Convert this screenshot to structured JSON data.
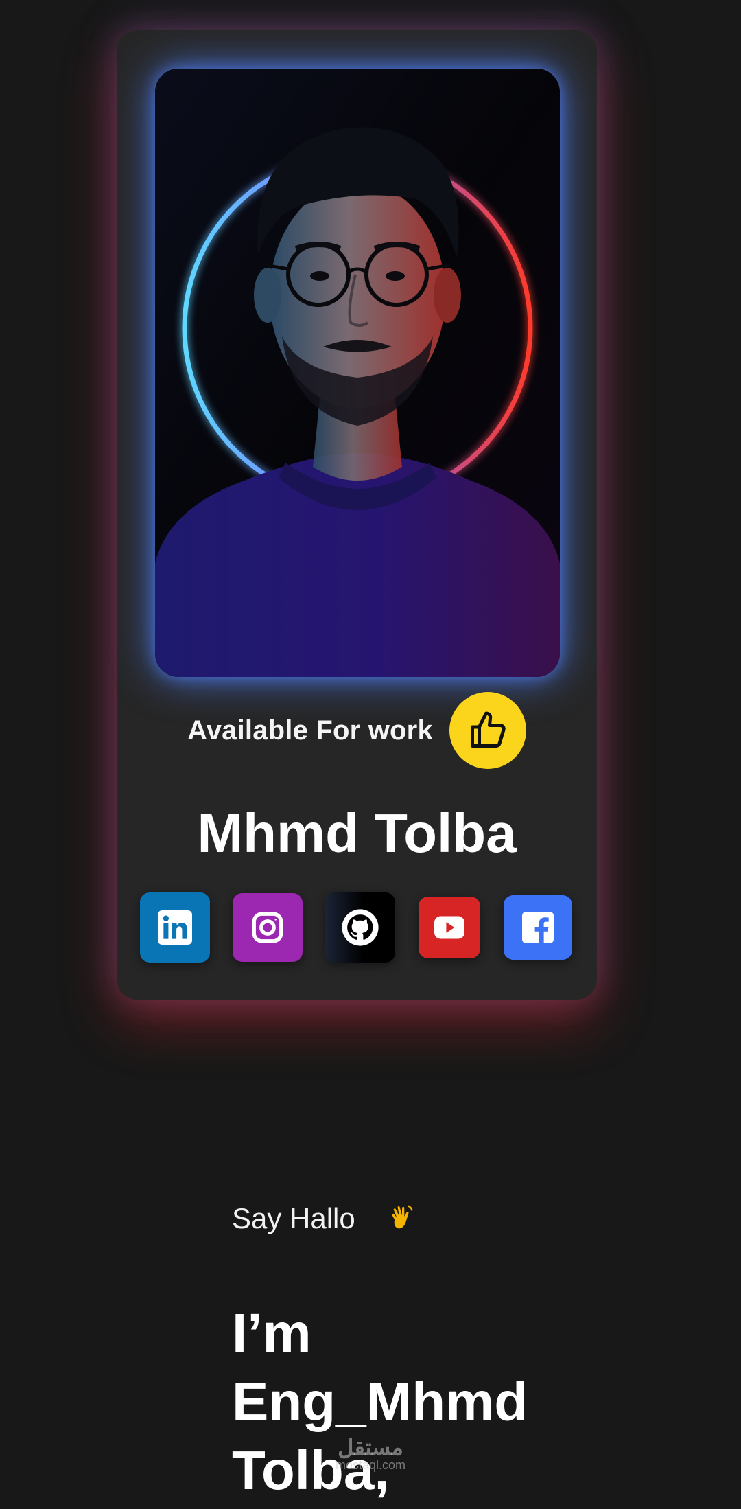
{
  "profile": {
    "availability": "Available For work",
    "name": "Mhmd Tolba",
    "photo_icon": "portrait-photo",
    "badge_icon": "thumbs-up-icon"
  },
  "socials": [
    {
      "network": "LinkedIn",
      "icon": "linkedin-icon",
      "color": "#0a75b5"
    },
    {
      "network": "Instagram",
      "icon": "instagram-icon",
      "color": "#9c27b0"
    },
    {
      "network": "GitHub",
      "icon": "github-icon",
      "color": "#000000"
    },
    {
      "network": "YouTube",
      "icon": "youtube-icon",
      "color": "#d72424"
    },
    {
      "network": "Facebook",
      "icon": "facebook-icon",
      "color": "#3b72f6"
    }
  ],
  "intro": {
    "greeting": "Say Hallo",
    "wave_emoji": "👋",
    "headline_line1": "I’m",
    "headline_line2": "Eng_Mhmd",
    "headline_line3": "Tolba,"
  },
  "watermark": {
    "arabic": "مستقل",
    "latin": "mostaql.com"
  },
  "colors": {
    "background": "#181818",
    "card": "#262626",
    "badge_yellow": "#fbd51c",
    "glow_blue": "#5082ff",
    "glow_red": "#dc2828"
  }
}
